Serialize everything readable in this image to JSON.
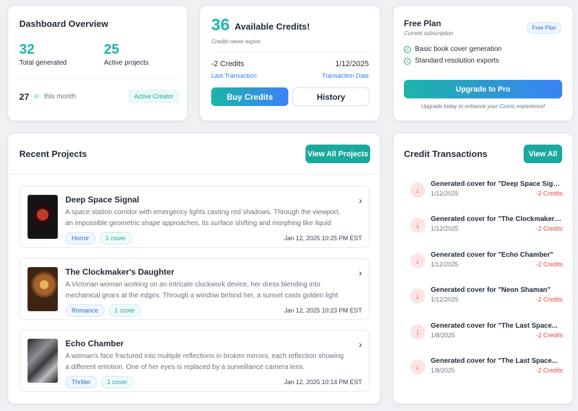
{
  "overview": {
    "title": "Dashboard Overview",
    "total_generated_value": "32",
    "total_generated_label": "Total generated",
    "active_projects_value": "25",
    "active_projects_label": "Active projects",
    "month_value": "27",
    "month_label": "this month",
    "badge": "Active Creator"
  },
  "credits": {
    "value": "36",
    "label": "Available Credits!",
    "note": "Credits never expire",
    "last_amount": "-2 Credits",
    "last_date": "1/12/2025",
    "last_label": "Last Transaction",
    "date_label": "Transaction Date",
    "buy_label": "Buy Credits",
    "history_label": "History"
  },
  "plan": {
    "title": "Free Plan",
    "subtitle": "Current subscription",
    "badge": "Free Plan",
    "features": [
      "Basic book cover generation",
      "Standard resolution exports"
    ],
    "upgrade_label": "Upgrade to Pro",
    "note": "Upgrade today to enhance your Covric experience!"
  },
  "recent": {
    "title": "Recent Projects",
    "view_all_label": "View All Projects",
    "projects": [
      {
        "title": "Deep Space Signal",
        "description": "A space station corridor with emergency lights casting red shadows. Through the viewport, an impossible geometric shape approaches, its surface shifting and morphing like liquid metal.",
        "genre": "Horror",
        "covers": "1 cover",
        "date": "Jan 12, 2025 10:25 PM EST"
      },
      {
        "title": "The Clockmaker's Daughter",
        "description": "A Victorian woman working on an intricate clockwork device, her dress blending into mechanical gears at the edges. Through a window behind her, a sunset casts golden light that makes the...",
        "genre": "Romance",
        "covers": "1 cover",
        "date": "Jan 12, 2025 10:23 PM EST"
      },
      {
        "title": "Echo Chamber",
        "description": "A woman's face fractured into multiple reflections in broken mirrors, each reflection showing a different emotion. One of her eyes is replaced by a surveillance camera lens.",
        "genre": "Thriller",
        "covers": "1 cover",
        "date": "Jan 12, 2025 10:14 PM EST"
      }
    ]
  },
  "transactions": {
    "title": "Credit Transactions",
    "view_all_label": "View All",
    "items": [
      {
        "title": "Generated cover for \"Deep Space Signal\"",
        "date": "1/12/2025",
        "amount": "-2 Credits"
      },
      {
        "title": "Generated cover for \"The Clockmaker's...",
        "date": "1/12/2025",
        "amount": "-2 Credits"
      },
      {
        "title": "Generated cover for \"Echo Chamber\"",
        "date": "1/12/2025",
        "amount": "-2 Credits"
      },
      {
        "title": "Generated cover for \"Neon Shaman\"",
        "date": "1/12/2025",
        "amount": "-2 Credits"
      },
      {
        "title": "Generated cover for \"The Last Space...",
        "date": "1/8/2025",
        "amount": "-2 Credits"
      },
      {
        "title": "Generated cover for \"The Last Space...",
        "date": "1/8/2025",
        "amount": "-2 Credits"
      }
    ]
  },
  "colors": {
    "teal": "#1cb5a8",
    "blue": "#3b82f6",
    "red": "#e04848"
  }
}
